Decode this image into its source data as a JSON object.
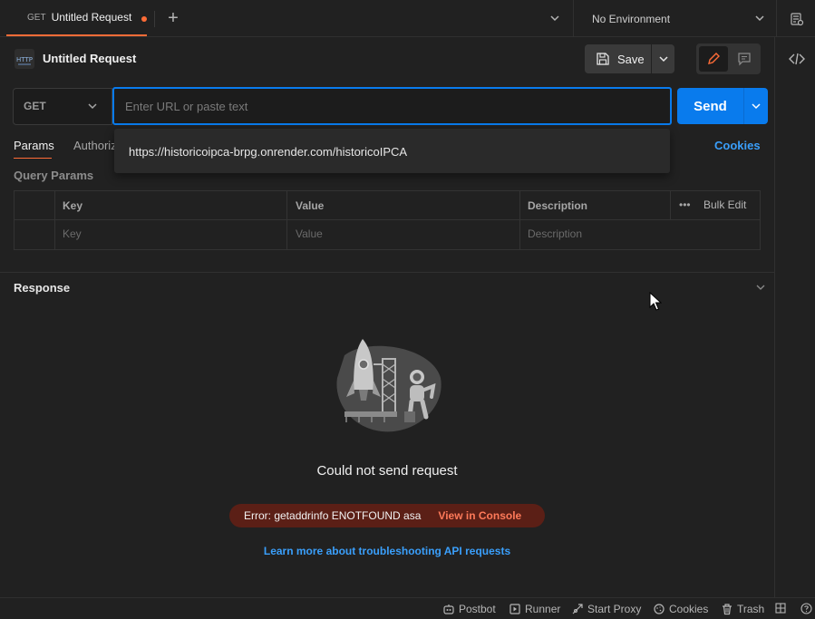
{
  "tabs": {
    "active": {
      "method": "GET",
      "title": "Untitled Request"
    },
    "new_tab": "+"
  },
  "environment": {
    "selected": "No Environment"
  },
  "request": {
    "title": "Untitled Request",
    "save_label": "Save",
    "method": "GET",
    "url_value": "",
    "url_placeholder": "Enter URL or paste text",
    "send_label": "Send",
    "autocomplete_suggestion": "https://historicoipca-brpg.onrender.com/historicoIPCA",
    "tabs": [
      {
        "label": "Params",
        "active": true
      },
      {
        "label": "Authoriz",
        "active": false
      }
    ],
    "cookies_label": "Cookies"
  },
  "query_params": {
    "title": "Query Params",
    "columns": [
      "Key",
      "Value",
      "Description"
    ],
    "bulk_edit_label": "Bulk Edit",
    "more_label": "•••",
    "placeholder_row": {
      "key": "Key",
      "value": "Value",
      "description": "Description"
    }
  },
  "response": {
    "title": "Response",
    "error_title": "Could not send request",
    "error_message": "Error: getaddrinfo ENOTFOUND asa",
    "view_console_label": "View in Console",
    "learn_more_label": "Learn more about troubleshooting API requests"
  },
  "statusbar": {
    "items": [
      {
        "label": "Postbot",
        "icon": "postbot-icon"
      },
      {
        "label": "Runner",
        "icon": "runner-icon"
      },
      {
        "label": "Start Proxy",
        "icon": "proxy-icon"
      },
      {
        "label": "Cookies",
        "icon": "cookie-icon"
      },
      {
        "label": "Trash",
        "icon": "trash-icon"
      }
    ]
  },
  "colors": {
    "accent_orange": "#ff6c37",
    "primary_blue": "#097bed",
    "link_blue": "#3a9ffb",
    "error_bg": "#5b1f16",
    "error_link": "#ff7a59",
    "background": "#212121"
  }
}
